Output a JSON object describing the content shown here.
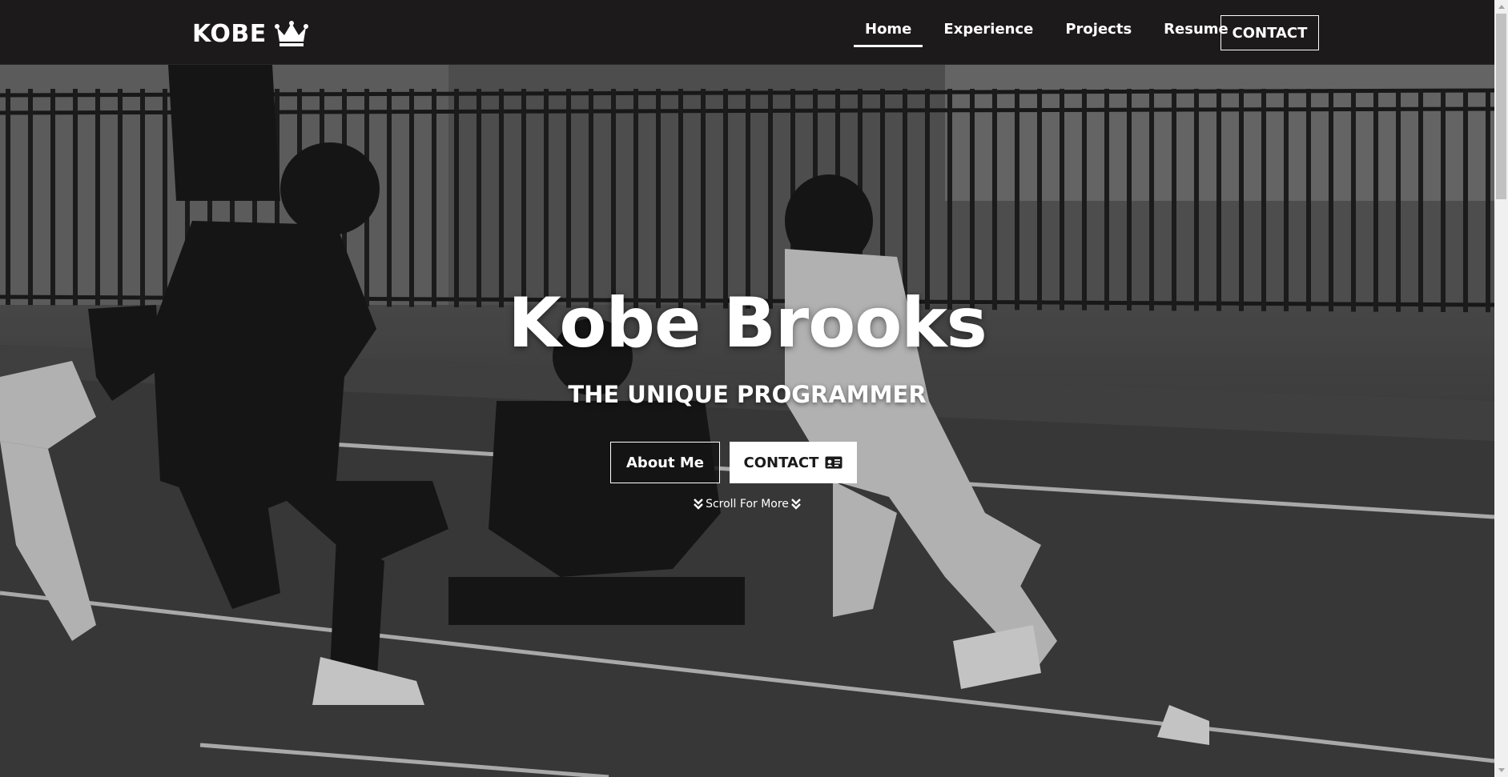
{
  "navbar": {
    "brand": "KOBE",
    "brand_icon": "crown-icon",
    "links": [
      {
        "label": "Home",
        "active": true
      },
      {
        "label": "Experience",
        "active": false
      },
      {
        "label": "Projects",
        "active": false
      },
      {
        "label": "Resume",
        "active": false
      }
    ],
    "contact_label": "CONTACT"
  },
  "hero": {
    "title": "Kobe Brooks",
    "subtitle": "THE UNIQUE PROGRAMMER",
    "about_label": "About Me",
    "contact_label": "CONTACT",
    "contact_icon": "id-card-icon",
    "scroll_label": "Scroll For More",
    "scroll_icon": "double-chevron-down-icon",
    "background": "black-and-white photo of a football game"
  },
  "colors": {
    "navbar_bg": "#1c1a1a",
    "text": "#ffffff",
    "contact_button_bg": "#ffffff",
    "contact_button_text": "#1a1a1a"
  }
}
